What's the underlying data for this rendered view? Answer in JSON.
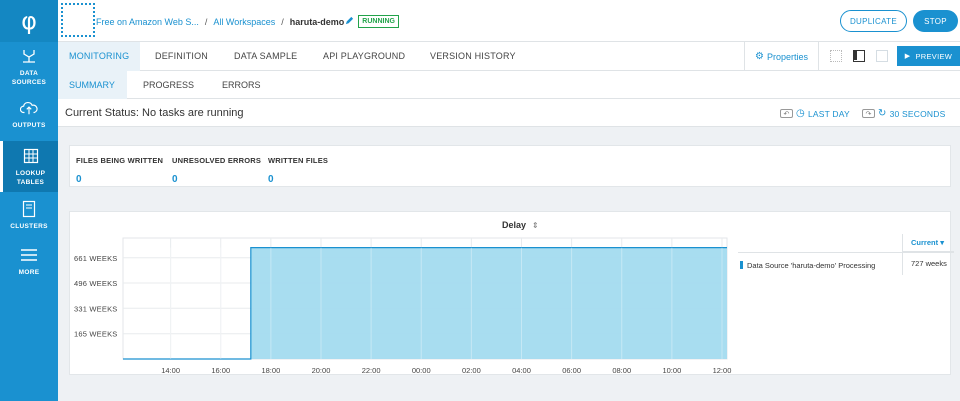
{
  "sidebar": {
    "logo": "φ",
    "items": [
      {
        "label_1": "DATA",
        "label_2": "SOURCES",
        "icon": "data-sources-icon"
      },
      {
        "label_1": "OUTPUTS",
        "label_2": "",
        "icon": "cloud-upload-icon"
      },
      {
        "label_1": "LOOKUP",
        "label_2": "TABLES",
        "icon": "table-icon",
        "active": true
      },
      {
        "label_1": "CLUSTERS",
        "label_2": "",
        "icon": "server-icon"
      },
      {
        "label_1": "MORE",
        "label_2": "",
        "icon": "hamburger-icon"
      }
    ]
  },
  "header": {
    "breadcrumb_account": "Free on Amazon Web S...",
    "breadcrumb_sep1": "/",
    "breadcrumb_workspaces": "All Workspaces",
    "breadcrumb_sep2": "/",
    "pipeline_name": "haruta-demo",
    "status_badge": "RUNNING",
    "duplicate_label": "DUPLICATE",
    "stop_label": "STOP"
  },
  "tabs": {
    "items": [
      "MONITORING",
      "DEFINITION",
      "DATA SAMPLE",
      "API PLAYGROUND",
      "VERSION HISTORY"
    ],
    "active": "MONITORING",
    "properties_label": "Properties",
    "preview_label": "PREVIEW"
  },
  "subtabs": {
    "items": [
      "SUMMARY",
      "PROGRESS",
      "ERRORS"
    ],
    "active": "SUMMARY"
  },
  "status": {
    "text": "Current Status: No tasks are running",
    "range_label": "LAST DAY",
    "refresh_label": "30 SECONDS"
  },
  "stats": [
    {
      "label": "FILES BEING WRITTEN",
      "value": "0"
    },
    {
      "label": "UNRESOLVED ERRORS",
      "value": "0"
    },
    {
      "label": "WRITTEN FILES",
      "value": "0"
    }
  ],
  "colors": {
    "accent": "#1a91d0",
    "area_fill": "#a3dbef",
    "running": "#22a34a"
  },
  "chart_data": {
    "type": "area",
    "title": "Delay",
    "x_ticks": [
      "14:00",
      "16:00",
      "18:00",
      "20:00",
      "22:00",
      "00:00",
      "02:00",
      "04:00",
      "06:00",
      "08:00",
      "10:00",
      "12:00"
    ],
    "y_ticks": [
      "165 WEEKS",
      "331 WEEKS",
      "496 WEEKS",
      "661 WEEKS"
    ],
    "y_tick_values": [
      165,
      331,
      496,
      661
    ],
    "ylim": [
      0,
      790
    ],
    "x_range_hours": [
      12.1,
      36.2
    ],
    "series": [
      {
        "name": "Data Source 'haruta-demo' Processing",
        "x_hours": [
          12.1,
          17.2,
          17.2,
          36.2
        ],
        "values": [
          0,
          0,
          727,
          727
        ],
        "current": "727 weeks"
      }
    ],
    "legend_header": "Current",
    "legend_sort_glyph": "▾",
    "grid": true
  }
}
